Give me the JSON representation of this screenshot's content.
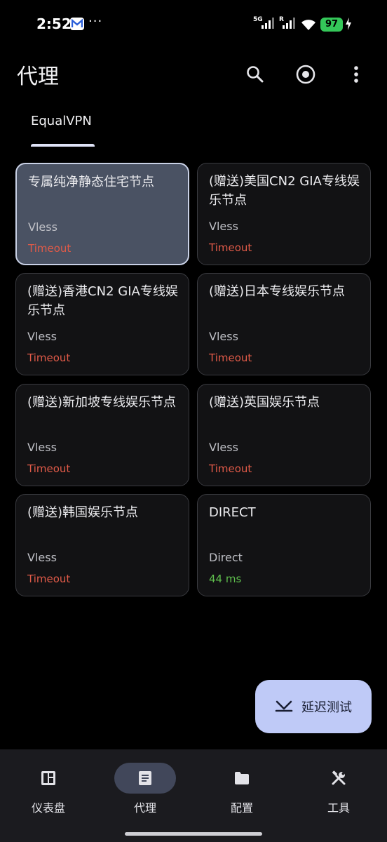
{
  "status_bar": {
    "time": "2:52",
    "more": "···",
    "net_label_1": "5G",
    "net_label_2": "R",
    "battery": "97"
  },
  "app_bar": {
    "title": "代理",
    "actions": [
      "search-icon",
      "target-icon",
      "more-vert-icon"
    ]
  },
  "tabs": [
    {
      "label": "EqualVPN",
      "selected": true
    }
  ],
  "proxies": [
    {
      "name": "专属纯净静态住宅节点",
      "type": "Vless",
      "delay": "Timeout"
    },
    {
      "name": "(赠送)美国CN2 GIA专线娱乐节点",
      "type": "Vless",
      "delay": "Timeout"
    },
    {
      "name": "(赠送)香港CN2 GIA专线娱乐节点",
      "type": "Vless",
      "delay": "Timeout"
    },
    {
      "name": "(赠送)日本专线娱乐节点",
      "type": "Vless",
      "delay": "Timeout"
    },
    {
      "name": "(赠送)新加坡专线娱乐节点",
      "type": "Vless",
      "delay": "Timeout"
    },
    {
      "name": "(赠送)英国娱乐节点",
      "type": "Vless",
      "delay": "Timeout"
    },
    {
      "name": "(赠送)韩国娱乐节点",
      "type": "Vless",
      "delay": "Timeout"
    },
    {
      "name": "DIRECT",
      "type": "Direct",
      "delay": "44 ms"
    }
  ],
  "fab": {
    "label": "延迟测试",
    "icon": "speed-test-icon"
  },
  "bottom_nav": [
    {
      "label": "仪表盘",
      "icon": "dashboard-icon"
    },
    {
      "label": "代理",
      "icon": "article-icon",
      "active": true
    },
    {
      "label": "配置",
      "icon": "folder-icon"
    },
    {
      "label": "工具",
      "icon": "tools-icon"
    }
  ],
  "colors": {
    "background": "#000000",
    "card": "#121214",
    "card_selected": "#4a5263",
    "timeout": "#e05a48",
    "ok": "#5fbf4d",
    "fab": "#bfcaf7",
    "nav_bg": "#1b1b1f",
    "nav_active": "#41475a"
  }
}
